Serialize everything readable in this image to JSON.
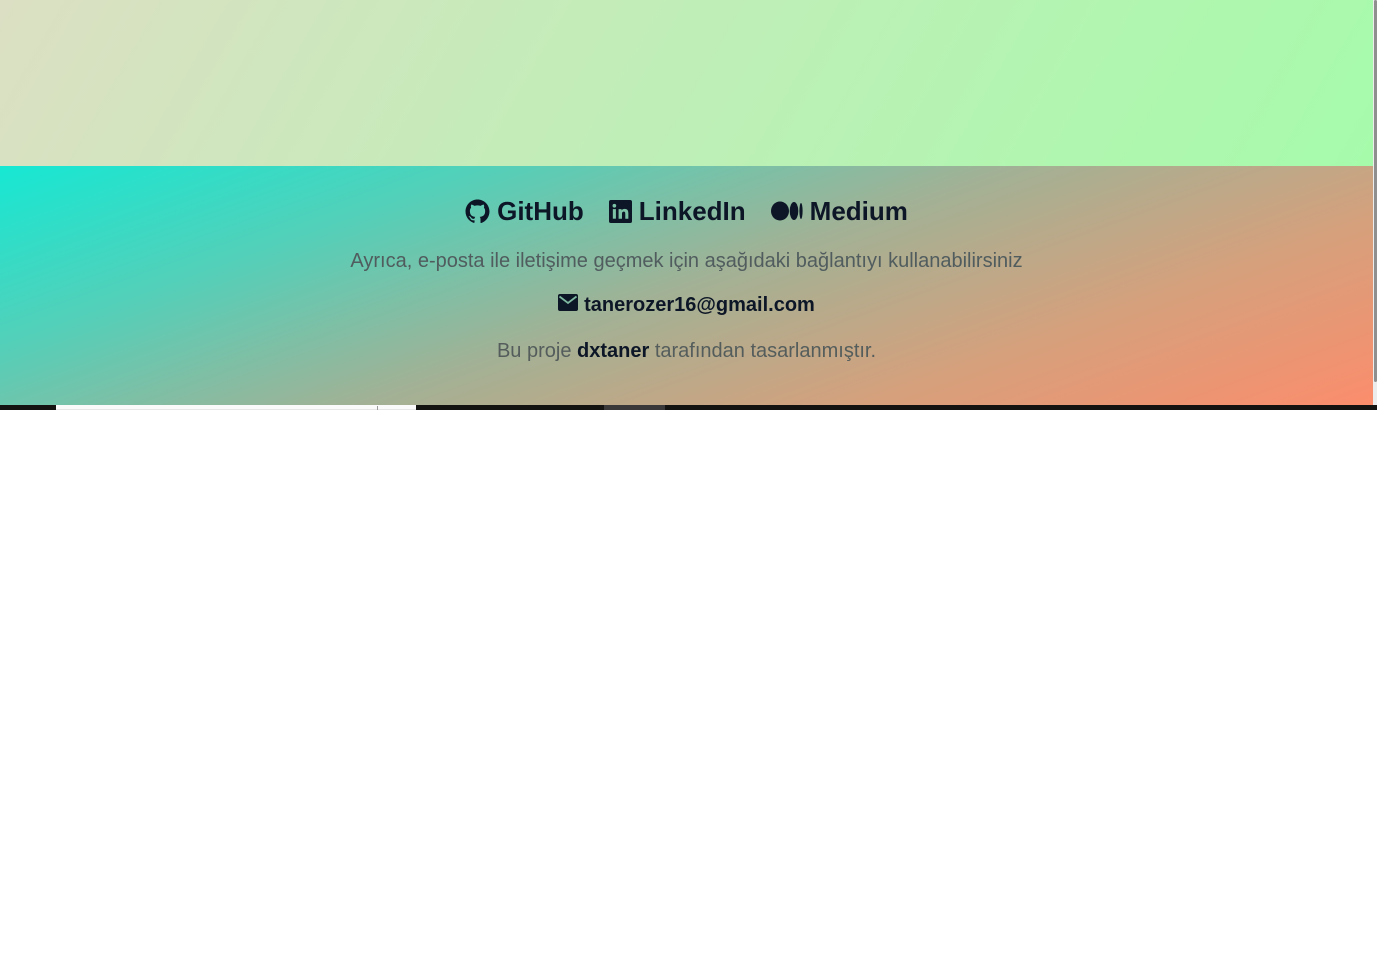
{
  "social": {
    "links": [
      {
        "label": "GitHub",
        "icon": "github-icon"
      },
      {
        "label": "LinkedIn",
        "icon": "linkedin-icon"
      },
      {
        "label": "Medium",
        "icon": "medium-icon"
      }
    ]
  },
  "contact": {
    "info_text": "Ayrıca, e-posta ile iletişime geçmek için aşağıdaki bağlantıyı kullanabilirsiniz",
    "email": "tanerozer16@gmail.com",
    "email_icon": "envelope-icon"
  },
  "credit": {
    "prefix": "Bu proje ",
    "author": "dxtaner",
    "suffix": " tarafından tasarlanmıştır."
  },
  "colors": {
    "top_gradient_start": "#dcdfc3",
    "top_gradient_end": "#a6fbab",
    "footer_gradient_start": "#16e8d3",
    "footer_gradient_end": "#fb8d6c",
    "text_dark": "#0c1626",
    "text_muted": "#505c5e"
  }
}
